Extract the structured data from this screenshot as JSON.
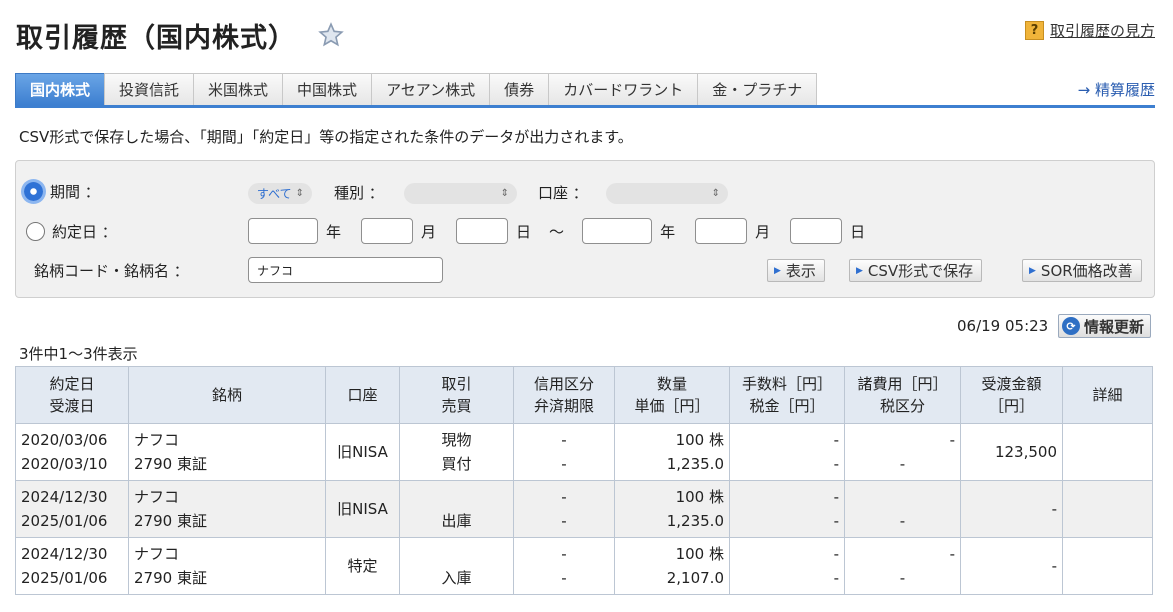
{
  "header": {
    "title": "取引履歴（国内株式）",
    "help_icon": "?",
    "help_link": "取引履歴の見方"
  },
  "tabs": [
    {
      "label": "国内株式",
      "active": true
    },
    {
      "label": "投資信託"
    },
    {
      "label": "米国株式"
    },
    {
      "label": "中国株式"
    },
    {
      "label": "アセアン株式"
    },
    {
      "label": "債券"
    },
    {
      "label": "カバードワラント"
    },
    {
      "label": "金・プラチナ"
    }
  ],
  "settlement_link": "→ 精算履歴",
  "csv_note": "CSV形式で保存した場合、「期間」「約定日」等の指定された条件のデータが出力されます。",
  "filter": {
    "period_label": "期間 ：",
    "period_value": "すべて",
    "type_label": "種別 ：",
    "account_label": "口座 ：",
    "trade_date_label": "約定日 ：",
    "year": "年",
    "month": "月",
    "day": "日",
    "tilde": "〜",
    "stock_label": "銘柄コード・銘柄名 ：",
    "stock_value": "ナフコ",
    "show_button": "表示",
    "csv_button": "CSV形式で保存",
    "sor_button": "SOR価格改善"
  },
  "timestamp": "06/19 05:23",
  "refresh_button": "情報更新",
  "count_text": "3件中1〜3件表示",
  "table": {
    "headers": [
      [
        "約定日",
        "受渡日"
      ],
      [
        "銘柄"
      ],
      [
        "口座"
      ],
      [
        "取引",
        "売買"
      ],
      [
        "信用区分",
        "弁済期限"
      ],
      [
        "数量",
        "単価［円］"
      ],
      [
        "手数料［円］",
        "税金［円］"
      ],
      [
        "諸費用［円］",
        "税区分"
      ],
      [
        "受渡金額",
        "［円］"
      ],
      [
        "詳細"
      ]
    ],
    "rows": [
      {
        "trade_date": "2020/03/06",
        "settle_date": "2020/03/10",
        "name": "ナフコ",
        "code": "2790 東証",
        "account": "旧NISA",
        "trade1": "現物",
        "trade2": "買付",
        "credit1": "-",
        "credit2": "-",
        "qty": "100 株",
        "price": "1,235.0",
        "fee": "-",
        "tax": "-",
        "cost": "-",
        "tax_class": "-",
        "amount": "123,500"
      },
      {
        "trade_date": "2024/12/30",
        "settle_date": "2025/01/06",
        "name": "ナフコ",
        "code": "2790 東証",
        "account": "旧NISA",
        "trade1": "",
        "trade2": "出庫",
        "credit1": "-",
        "credit2": "-",
        "qty": "100 株",
        "price": "1,235.0",
        "fee": "-",
        "tax": "-",
        "cost": "",
        "tax_class": "-",
        "amount": "-"
      },
      {
        "trade_date": "2024/12/30",
        "settle_date": "2025/01/06",
        "name": "ナフコ",
        "code": "2790 東証",
        "account": "特定",
        "trade1": "",
        "trade2": "入庫",
        "credit1": "-",
        "credit2": "-",
        "qty": "100 株",
        "price": "2,107.0",
        "fee": "-",
        "tax": "-",
        "cost": "-",
        "tax_class": "-",
        "amount": "-"
      }
    ]
  }
}
